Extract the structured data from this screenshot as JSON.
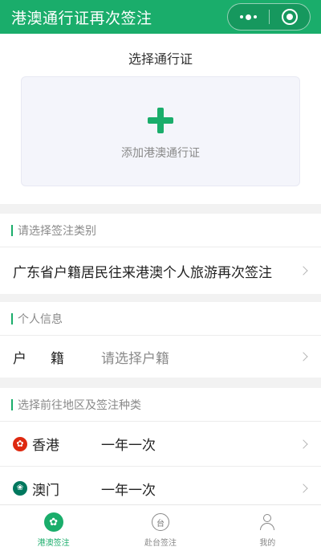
{
  "header": {
    "title": "港澳通行证再次签注"
  },
  "pass_card": {
    "title": "选择通行证",
    "add_label": "添加港澳通行证"
  },
  "visa_category": {
    "section_label": "请选择签注类别",
    "value": "广东省户籍居民往来港澳个人旅游再次签注"
  },
  "personal_info": {
    "section_label": "个人信息",
    "household_label": "户籍",
    "household_placeholder": "请选择户籍"
  },
  "destination": {
    "section_label": "选择前往地区及签注种类",
    "regions": [
      {
        "name": "香港",
        "value": "一年一次",
        "flag_icon": "hong-kong-flag-icon",
        "color": "#de2910"
      },
      {
        "name": "澳门",
        "value": "一年一次",
        "flag_icon": "macau-flag-icon",
        "color": "#00785e"
      }
    ]
  },
  "tabbar": {
    "tabs": [
      {
        "label": "港澳签注",
        "icon": "bauhinia-icon",
        "active": true
      },
      {
        "label": "赴台签注",
        "icon": "taiwan-icon",
        "active": false
      },
      {
        "label": "我的",
        "icon": "user-icon",
        "active": false
      }
    ]
  },
  "colors": {
    "accent": "#1aad6b",
    "background": "#f2f2f2"
  }
}
